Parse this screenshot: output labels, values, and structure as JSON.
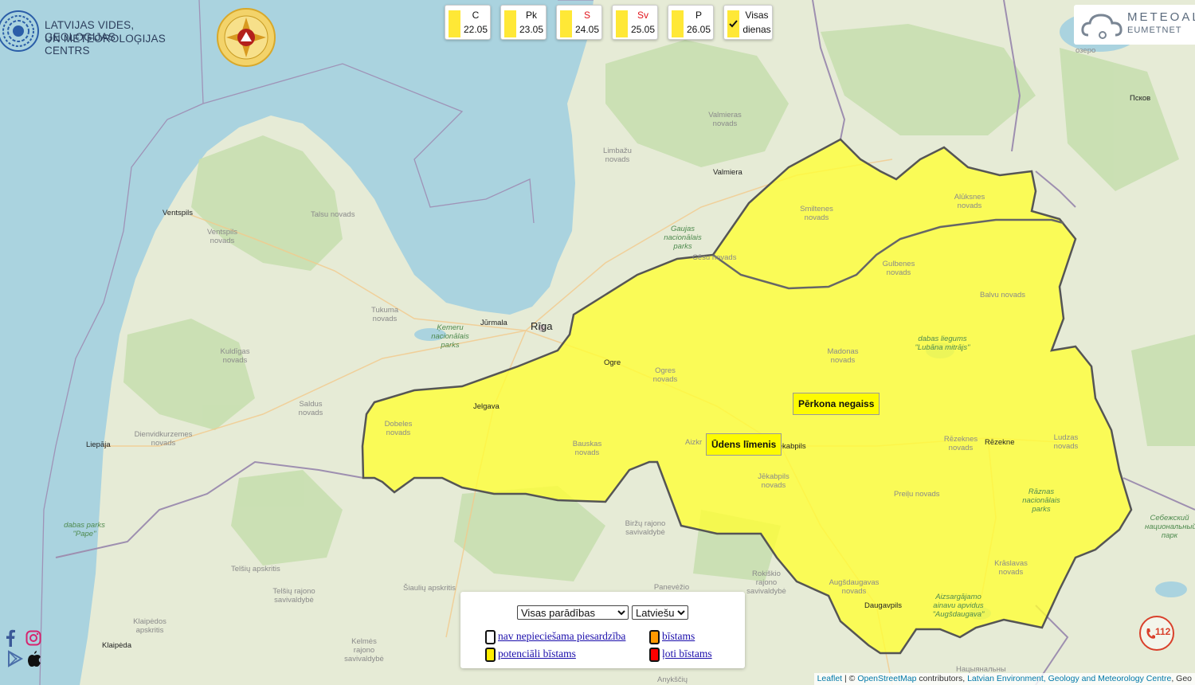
{
  "header": {
    "org_line1": "LATVIJAS VIDES, ĢEOLOĢIJAS",
    "org_line2": "UN METEOROLOĢIJAS CENTRS",
    "meteoalarm_line1": "METEOAL",
    "meteoalarm_line2": "EUMETNET"
  },
  "days": [
    {
      "name": "C",
      "date": "22.05",
      "weekend": false
    },
    {
      "name": "Pk",
      "date": "23.05",
      "weekend": false
    },
    {
      "name": "S",
      "date": "24.05",
      "weekend": true
    },
    {
      "name": "Sv",
      "date": "25.05",
      "weekend": true
    },
    {
      "name": "P",
      "date": "26.05",
      "weekend": false
    }
  ],
  "all_days": {
    "label_line1": "Visas",
    "label_line2": "dienas",
    "checked": true
  },
  "warnings": [
    {
      "label": "Pērkona negaiss",
      "level": "potenciāli bīstams"
    },
    {
      "label": "Ūdens līmenis",
      "level": "potenciāli bīstams"
    }
  ],
  "controls": {
    "phenomenon_select": "Visas parādības",
    "language_select": "Latviešu"
  },
  "legend": [
    {
      "label": "nav nepieciešama piesardzība",
      "color": "#ffffff"
    },
    {
      "label": "bīstams",
      "color": "#ff9900"
    },
    {
      "label": "potenciāli bīstams",
      "color": "#ffee00"
    },
    {
      "label": "ļoti bīstams",
      "color": "#ff0000"
    }
  ],
  "attribution": {
    "leaflet": "Leaflet",
    "sep": " | © ",
    "osm": "OpenStreetMap",
    "contrib": " contributors, ",
    "lvgmc": "Latvian Environment, Geology and Meteorology Centre",
    "tail": ", Geo"
  },
  "emergency": {
    "number": "112"
  },
  "places": {
    "ventspils": "Ventspils",
    "ventspils_nov": "Ventspils novads",
    "talsu_nov": "Talsu novads",
    "tukuma_nov": "Tukuma novads",
    "kuldigas_nov": "Kuldīgas novads",
    "saldus_nov": "Saldus novads",
    "liepaja": "Liepāja",
    "dienvidkurzemes_nov": "Dienvidkurzemes novads",
    "pape": "dabas parks \"Pape\"",
    "jurmala": "Jūrmala",
    "riga": "Rīga",
    "kemeru": "Ķemeru nacionālais parks",
    "limbazu_nov": "Limbažu novads",
    "valmieras_nov": "Valmieras novads",
    "valmiera": "Valmiera",
    "gaujas": "Gaujas nacionālais parks",
    "cesu_nov": "Cēsu novads",
    "smiltenes_nov": "Smiltenes novads",
    "aluksnes_nov": "Alūksnes novads",
    "gulbenes_nov": "Gulbenes novads",
    "balvu_nov": "Balvu novads",
    "lubana": "dabas liegums \"Lubāna mitrājs\"",
    "madonas_nov": "Madonas novads",
    "ogre": "Ogre",
    "ogres_nov": "Ogres novads",
    "jelgava": "Jelgava",
    "dobeles_nov": "Dobeles novads",
    "bauskas_nov": "Bauskas novads",
    "aizkraukle": "Aizkr",
    "jekabpils": "Jēkabpils",
    "jekabpils_nov": "Jēkabpils novads",
    "rezekne": "Rēzekne",
    "rezeknes_nov": "Rēzeknes novads",
    "ludzas_nov": "Ludzas novads",
    "preilu_nov": "Preiļu novads",
    "raznas": "Rāznas nacionālais parks",
    "kraslavas_nov": "Krāslavas novads",
    "augsdaugavas_nov": "Augšdaugavas novads",
    "daugavpils": "Daugavpils",
    "aizsargajamo": "Aizsargājamo ainavu apvidus \"Augšdaugava\"",
    "birzu": "Biržų rajono savivaldybė",
    "rokiskio": "Rokiškio rajono savivaldybė",
    "panevezio": "Panevėžio apskritis",
    "siauliu": "Šiaulių apskritis",
    "telsiu": "Telšių apskritis",
    "telsiu_raj": "Telšių rajono savivaldybė",
    "klaipedos": "Klaipėdos apskritis",
    "klaipeda": "Klaipėda",
    "kelmes": "Kelmės rajono savivaldybė",
    "anyksciu": "Anykščių",
    "pskov": "Псков",
    "ozero": "озеро",
    "sebezh": "Себежский национальный парк",
    "nacionalny": "Нацыянальны"
  }
}
